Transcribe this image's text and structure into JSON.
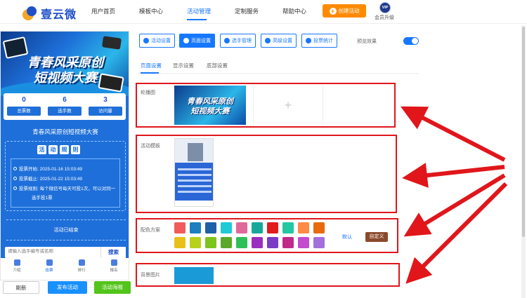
{
  "nav": {
    "logo_text": "壹云微",
    "items": [
      "用户首页",
      "模板中心",
      "活动管理",
      "定制服务",
      "帮助中心"
    ],
    "create_button": "创建活动",
    "vip_badge": "VIP",
    "vip_label": "会员升级"
  },
  "preview": {
    "banner_line1": "青春风采原创",
    "banner_line2": "短视频大赛",
    "stats": [
      {
        "value": "0",
        "label": "总票数"
      },
      {
        "value": "6",
        "label": "选手数"
      },
      {
        "value": "3",
        "label": "访问量"
      }
    ],
    "title": "青春风采原创短视频大赛",
    "rules_heading": [
      "活",
      "动",
      "规",
      "则"
    ],
    "rules": [
      {
        "label": "投票开始:",
        "text": "2025-01-16 15:03:49"
      },
      {
        "label": "投票截止:",
        "text": "2025-01-22 15:03:49"
      },
      {
        "label": "投票规则:",
        "text": "每个微信号每天可投1次，可以对同一"
      },
      {
        "label": "",
        "text": "选手投1票"
      }
    ],
    "ended_text": "活动已结束",
    "search_placeholder": "请输入选手编号或名称",
    "search_button": "搜索",
    "tabs": [
      "介绍",
      "投票",
      "排行",
      "报名"
    ]
  },
  "actions": {
    "refresh": "刷新",
    "publish": "发布活动",
    "poster": "活动海报"
  },
  "toolbar": {
    "buttons": [
      "活动设置",
      "页面设置",
      "选手管理",
      "高级设置",
      "投票统计"
    ],
    "active_index": 1,
    "preview_label": "预览效果",
    "preview_enabled": true
  },
  "subtabs": [
    "页面设置",
    "显示设置",
    "底部设置"
  ],
  "settings": {
    "carousel_label": "轮播图",
    "carousel_line1": "青春风采原创",
    "carousel_line2": "短视频大赛",
    "add_symbol": "+",
    "template_label": "活动模板",
    "color_label": "配色方案",
    "default_label": "默认",
    "custom_label": "自定义",
    "bg_label": "背景图片"
  },
  "colors": {
    "accent": "#1677ff",
    "annotation_red": "#e0161b",
    "swatches_row1": [
      "#f25b5b",
      "#1d7fbf",
      "#1e5fa8",
      "#1fc9d6",
      "#e0699a",
      "#17a89a",
      "#e01c1c",
      "#23c7a0",
      "#ff8a45",
      "#e86a0c"
    ],
    "swatches_row2": [
      "#e8c01a",
      "#b8d11a",
      "#7cc41e",
      "#5aa82a",
      "#2fbf5a",
      "#9b2ec0",
      "#7a3cc4",
      "#c02a8a",
      "#c44ad0",
      "#a36fdc"
    ],
    "background_swatch": "#1a9ad6"
  }
}
